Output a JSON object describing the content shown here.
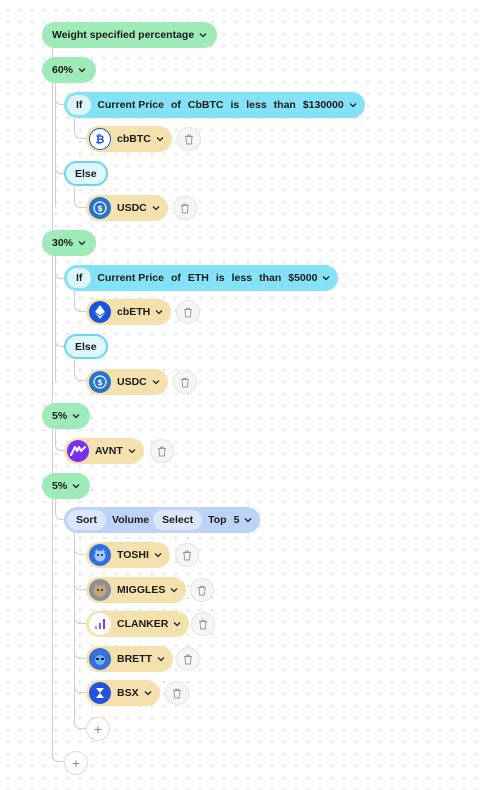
{
  "root": {
    "label": "Weight specified percentage"
  },
  "groups": [
    {
      "weight": "60%",
      "condition": {
        "if": "If",
        "subject": "Current Price",
        "of": "of",
        "asset": "CbBTC",
        "is": "is",
        "comparator": "less",
        "than": "than",
        "value": "$130000"
      },
      "then_token": "cbBTC",
      "else_label": "Else",
      "else_token": "USDC"
    },
    {
      "weight": "30%",
      "condition": {
        "if": "If",
        "subject": "Current Price",
        "of": "of",
        "asset": "ETH",
        "is": "is",
        "comparator": "less",
        "than": "than",
        "value": "$5000"
      },
      "then_token": "cbETH",
      "else_label": "Else",
      "else_token": "USDC"
    },
    {
      "weight": "5%",
      "token": "AVNT"
    },
    {
      "weight": "5%",
      "sort": {
        "sort": "Sort",
        "metric": "Volume",
        "select": "Select",
        "top": "Top",
        "count": "5"
      },
      "tokens": [
        "TOSHI",
        "MIGGLES",
        "CLANKER",
        "BRETT",
        "BSX"
      ]
    }
  ],
  "add_symbol": "+",
  "icons": {
    "chevron": "chevron-down-icon",
    "trash": "trash-icon",
    "plus": "plus-icon"
  },
  "colors": {
    "green": "#9eeab9",
    "cyan": "#84e2f6",
    "yellow": "#f5e1ad",
    "blue": "#bcd3f7"
  }
}
